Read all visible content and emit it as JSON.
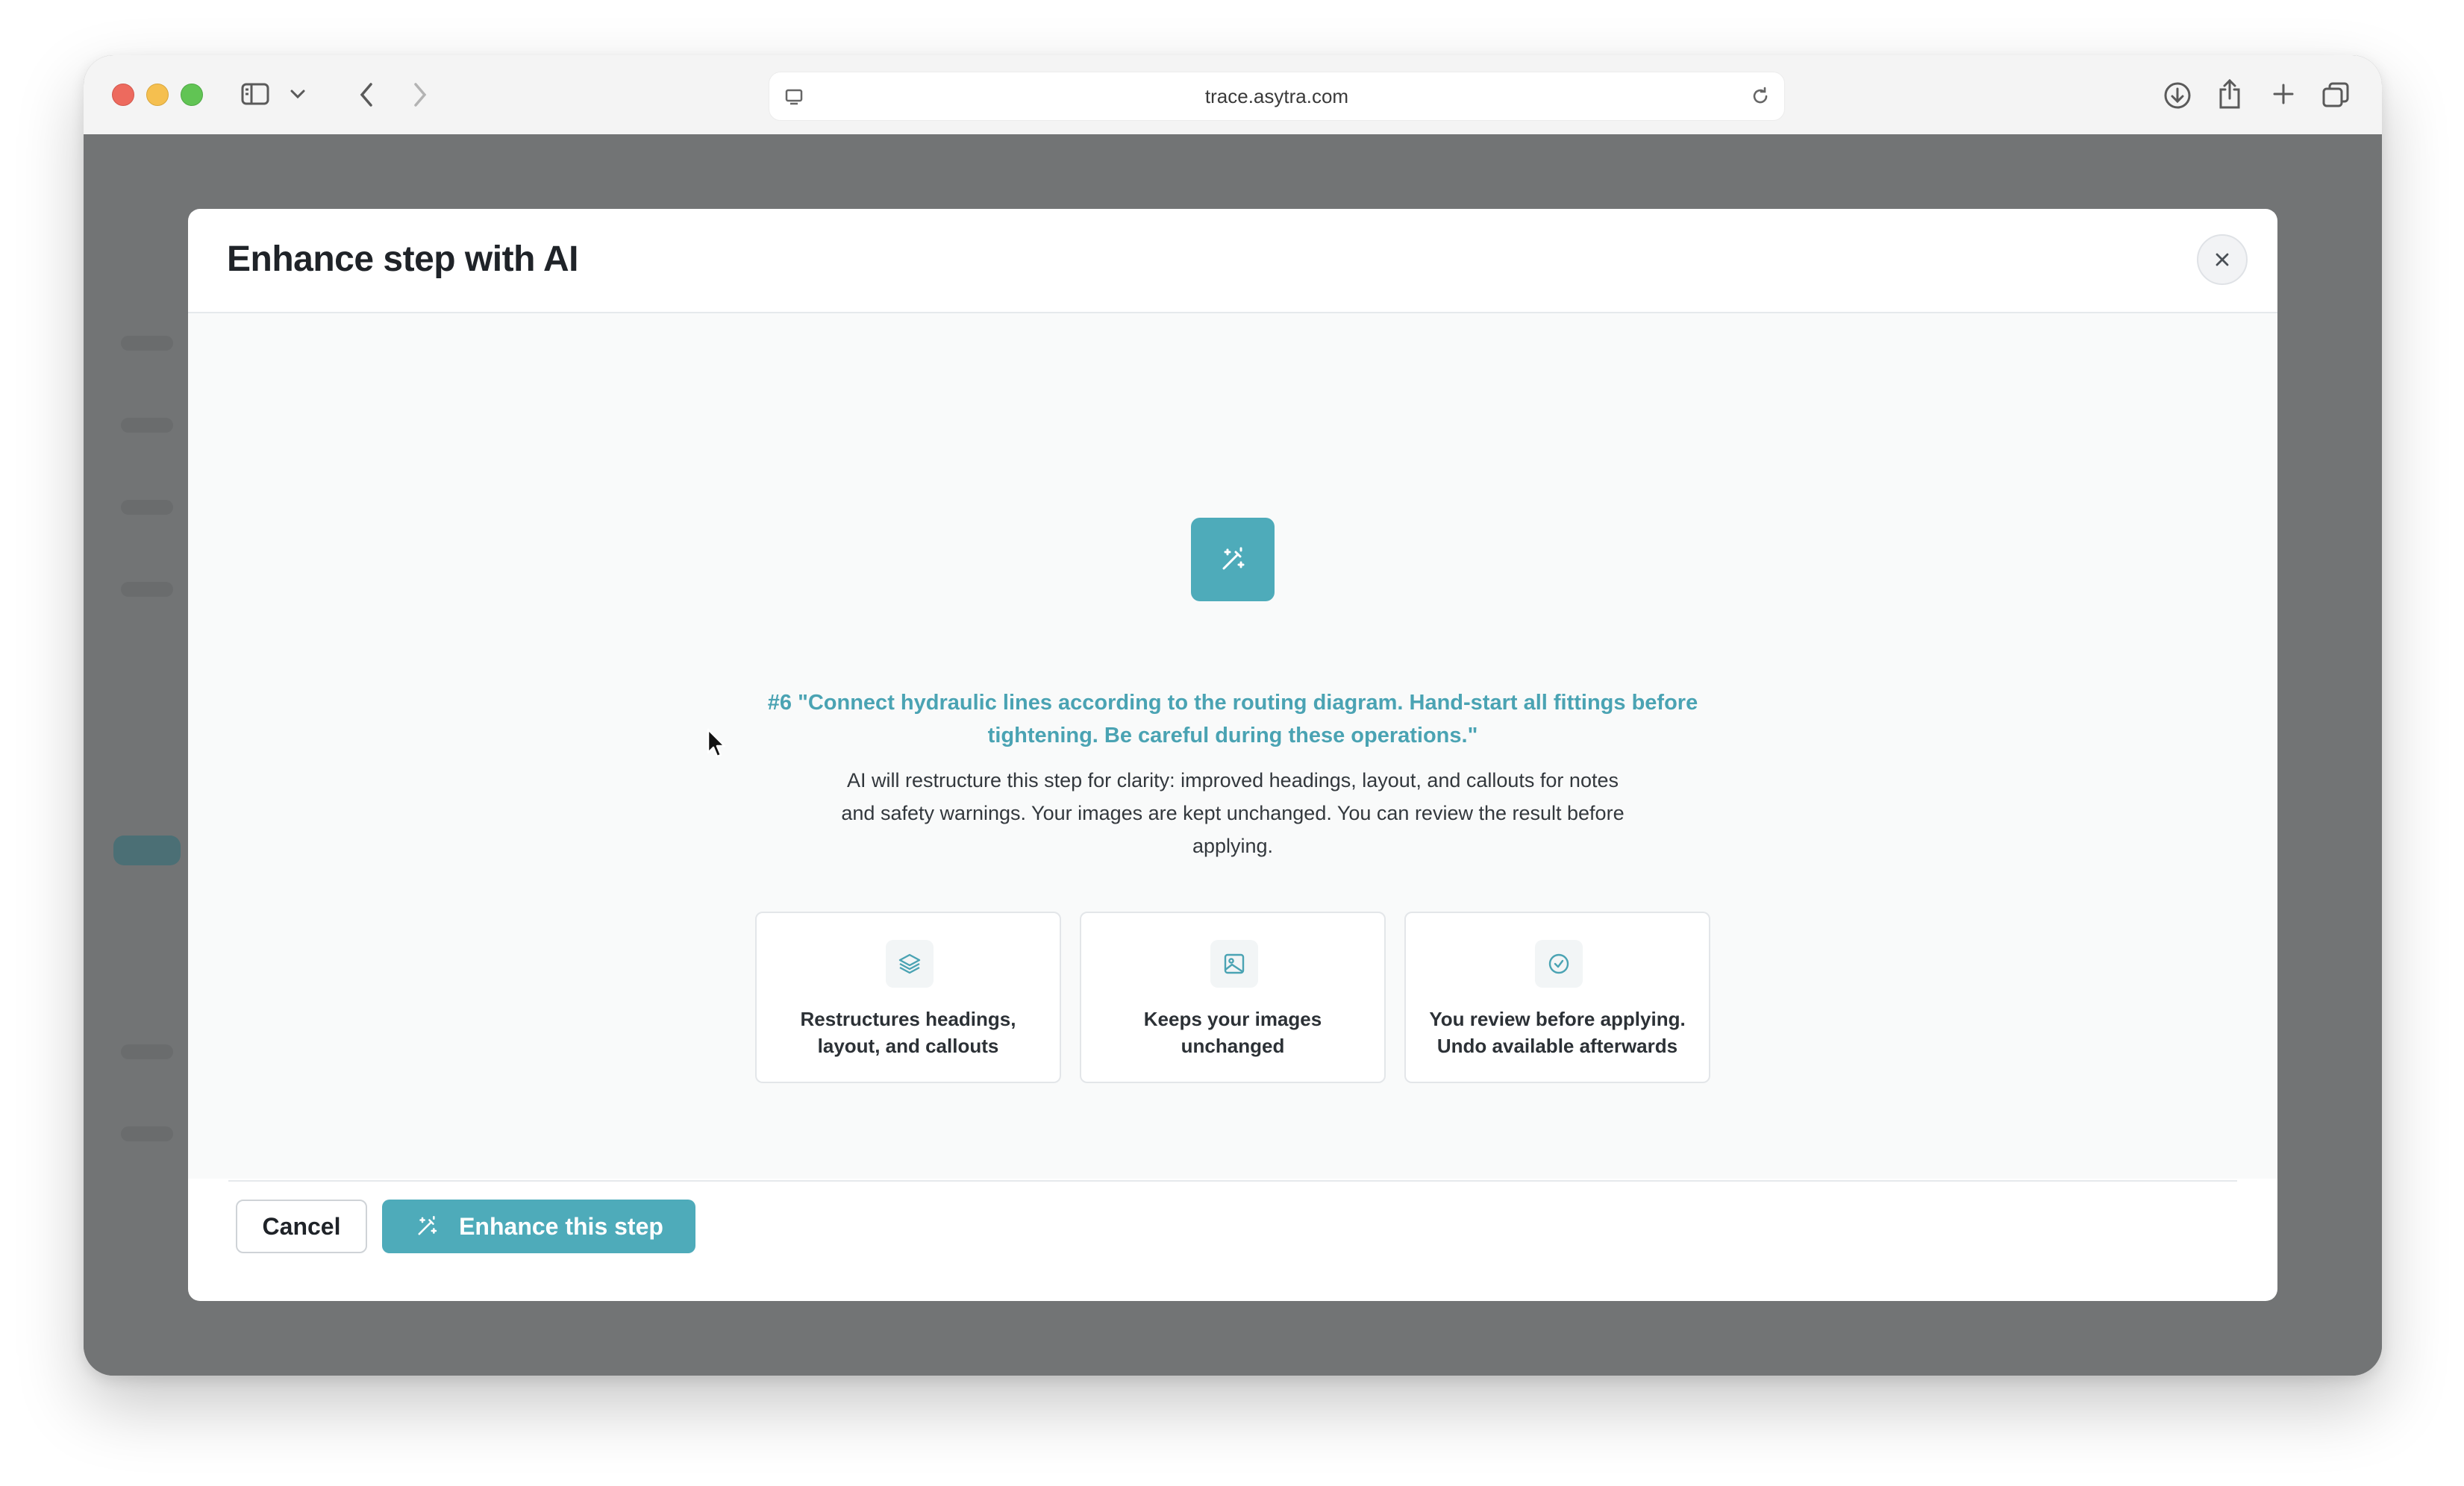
{
  "browser": {
    "url": "trace.asytra.com",
    "icons": {
      "sidebar": "sidebar-toggle-icon",
      "tab_menu": "chevron-down-icon",
      "back": "back-icon",
      "forward": "forward-icon",
      "site": "site-settings-icon",
      "reload": "reload-icon",
      "download": "download-icon",
      "share": "share-icon",
      "new_tab": "plus-icon",
      "tabs": "tab-overview-icon"
    }
  },
  "modal": {
    "title": "Enhance step with AI",
    "step_quote": "#6 \"Connect hydraulic lines according to the routing diagram. Hand-start all fittings before tightening. Be careful during these operations.\"",
    "description": "AI will restructure this step for clarity: improved headings, layout, and callouts for notes and safety warnings. Your images are kept unchanged. You can review the result before applying.",
    "features": [
      {
        "icon": "layers-icon",
        "label": "Restructures headings, layout, and callouts"
      },
      {
        "icon": "image-icon",
        "label": "Keeps your images unchanged"
      },
      {
        "icon": "check-circle-icon",
        "label": "You review before applying. Undo available afterwards"
      }
    ],
    "cancel_label": "Cancel",
    "enhance_label": "Enhance this step"
  },
  "colors": {
    "accent": "#4eabba",
    "accent_text": "#4aa3b3",
    "overlay": "#727475"
  }
}
